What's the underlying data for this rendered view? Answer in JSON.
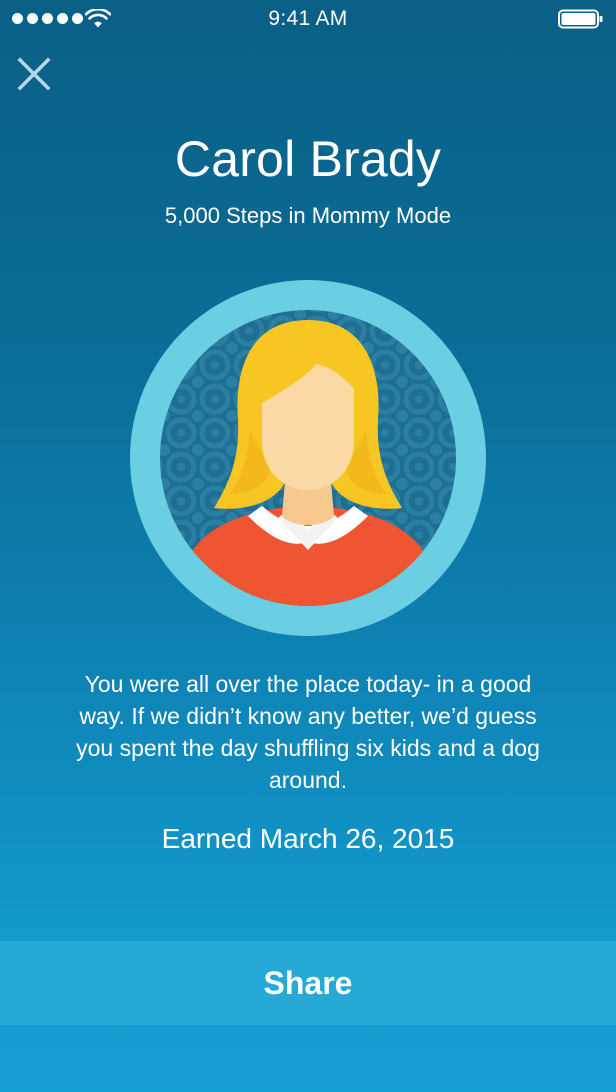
{
  "status_bar": {
    "time": "9:41 AM",
    "signal_icon": "signal-dots-icon",
    "wifi_icon": "wifi-icon",
    "battery_icon": "battery-icon"
  },
  "header": {
    "close_icon": "close-icon"
  },
  "badge": {
    "title": "Carol Brady",
    "subtitle": "5,000 Steps in Mommy Mode",
    "icon": "avatar-badge-icon"
  },
  "description": "You were all over the place today- in a good way. If we didn’t know any better, we’d guess you spent the day shuffling six kids and a dog around.",
  "earned": "Earned March 26, 2015",
  "share_label": "Share",
  "colors": {
    "ring": "#6acfe3",
    "pattern_bg": "#1f6e93",
    "pattern_fg": "#2b7fa3",
    "hair": "#f8c622",
    "skin": "#fbd9a4",
    "sweater": "#ef5532",
    "share_bg": "#27a9d8"
  }
}
